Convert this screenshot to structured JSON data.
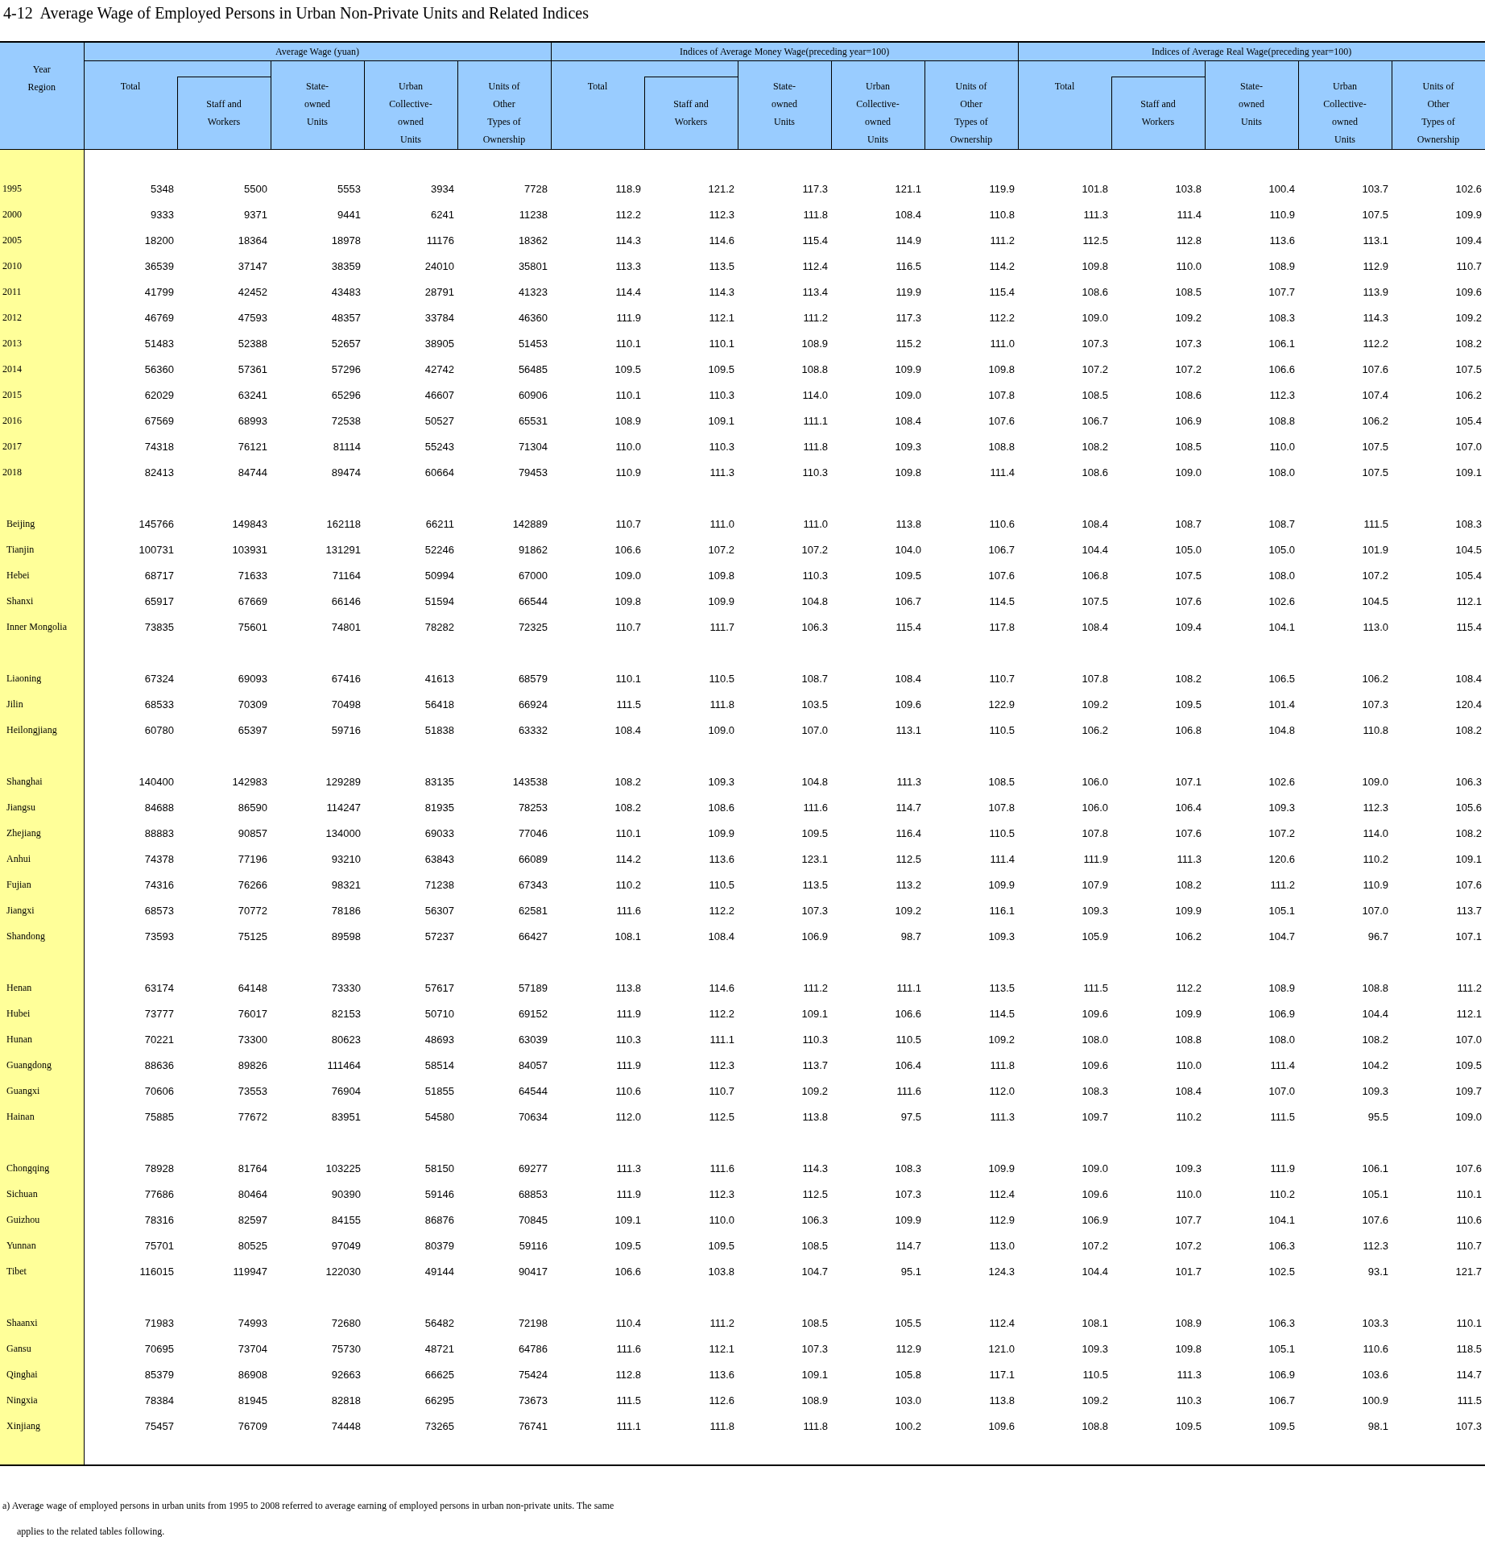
{
  "title": "4-12  Average Wage of Employed Persons in Urban Non-Private Units and Related Indices",
  "table": {
    "stub_header": "Year\nRegion",
    "column_groups": [
      {
        "title": "Average Wage  (yuan)",
        "columns": [
          {
            "label": "Total",
            "kind": "total"
          },
          {
            "label": "Staff and\nWorkers",
            "kind": "sub"
          },
          {
            "label": "State-\nowned\nUnits",
            "kind": "plain"
          },
          {
            "label": "Urban\nCollective-\nowned\nUnits",
            "kind": "plain"
          },
          {
            "label": "Units of\nOther\nTypes of\nOwnership",
            "kind": "plain"
          }
        ]
      },
      {
        "title": "Indices of Average Money Wage(preceding year=100)",
        "columns": [
          {
            "label": "Total",
            "kind": "total"
          },
          {
            "label": "Staff and\nWorkers",
            "kind": "sub"
          },
          {
            "label": "State-\nowned\nUnits",
            "kind": "plain"
          },
          {
            "label": "Urban\nCollective-\nowned\nUnits",
            "kind": "plain"
          },
          {
            "label": "Units of\nOther\nTypes of\nOwnership",
            "kind": "plain"
          }
        ]
      },
      {
        "title": "Indices of Average Real Wage(preceding year=100)",
        "columns": [
          {
            "label": "Total",
            "kind": "total"
          },
          {
            "label": "Staff and\nWorkers",
            "kind": "sub"
          },
          {
            "label": "State-\nowned\nUnits",
            "kind": "plain"
          },
          {
            "label": "Urban\nCollective-\nowned\nUnits",
            "kind": "plain"
          },
          {
            "label": "Units of\nOther\nTypes of\nOwnership",
            "kind": "plain"
          }
        ]
      }
    ],
    "row_groups": [
      {
        "kind": "years",
        "rows": [
          {
            "label": "1995",
            "values": [
              "5348",
              "5500",
              "5553",
              "3934",
              "7728",
              "118.9",
              "121.2",
              "117.3",
              "121.1",
              "119.9",
              "101.8",
              "103.8",
              "100.4",
              "103.7",
              "102.6"
            ]
          },
          {
            "label": "2000",
            "values": [
              "9333",
              "9371",
              "9441",
              "6241",
              "11238",
              "112.2",
              "112.3",
              "111.8",
              "108.4",
              "110.8",
              "111.3",
              "111.4",
              "110.9",
              "107.5",
              "109.9"
            ]
          },
          {
            "label": "2005",
            "values": [
              "18200",
              "18364",
              "18978",
              "11176",
              "18362",
              "114.3",
              "114.6",
              "115.4",
              "114.9",
              "111.2",
              "112.5",
              "112.8",
              "113.6",
              "113.1",
              "109.4"
            ]
          },
          {
            "label": "2010",
            "values": [
              "36539",
              "37147",
              "38359",
              "24010",
              "35801",
              "113.3",
              "113.5",
              "112.4",
              "116.5",
              "114.2",
              "109.8",
              "110.0",
              "108.9",
              "112.9",
              "110.7"
            ]
          },
          {
            "label": "2011",
            "values": [
              "41799",
              "42452",
              "43483",
              "28791",
              "41323",
              "114.4",
              "114.3",
              "113.4",
              "119.9",
              "115.4",
              "108.6",
              "108.5",
              "107.7",
              "113.9",
              "109.6"
            ]
          },
          {
            "label": "2012",
            "values": [
              "46769",
              "47593",
              "48357",
              "33784",
              "46360",
              "111.9",
              "112.1",
              "111.2",
              "117.3",
              "112.2",
              "109.0",
              "109.2",
              "108.3",
              "114.3",
              "109.2"
            ]
          },
          {
            "label": "2013",
            "values": [
              "51483",
              "52388",
              "52657",
              "38905",
              "51453",
              "110.1",
              "110.1",
              "108.9",
              "115.2",
              "111.0",
              "107.3",
              "107.3",
              "106.1",
              "112.2",
              "108.2"
            ]
          },
          {
            "label": "2014",
            "values": [
              "56360",
              "57361",
              "57296",
              "42742",
              "56485",
              "109.5",
              "109.5",
              "108.8",
              "109.9",
              "109.8",
              "107.2",
              "107.2",
              "106.6",
              "107.6",
              "107.5"
            ]
          },
          {
            "label": "2015",
            "values": [
              "62029",
              "63241",
              "65296",
              "46607",
              "60906",
              "110.1",
              "110.3",
              "114.0",
              "109.0",
              "107.8",
              "108.5",
              "108.6",
              "112.3",
              "107.4",
              "106.2"
            ]
          },
          {
            "label": "2016",
            "values": [
              "67569",
              "68993",
              "72538",
              "50527",
              "65531",
              "108.9",
              "109.1",
              "111.1",
              "108.4",
              "107.6",
              "106.7",
              "106.9",
              "108.8",
              "106.2",
              "105.4"
            ]
          },
          {
            "label": "2017",
            "values": [
              "74318",
              "76121",
              "81114",
              "55243",
              "71304",
              "110.0",
              "110.3",
              "111.8",
              "109.3",
              "108.8",
              "108.2",
              "108.5",
              "110.0",
              "107.5",
              "107.0"
            ]
          },
          {
            "label": "2018",
            "values": [
              "82413",
              "84744",
              "89474",
              "60664",
              "79453",
              "110.9",
              "111.3",
              "110.3",
              "109.8",
              "111.4",
              "108.6",
              "109.0",
              "108.0",
              "107.5",
              "109.1"
            ]
          }
        ]
      },
      {
        "kind": "regions",
        "rows": [
          {
            "label": "Beijing",
            "values": [
              "145766",
              "149843",
              "162118",
              "66211",
              "142889",
              "110.7",
              "111.0",
              "111.0",
              "113.8",
              "110.6",
              "108.4",
              "108.7",
              "108.7",
              "111.5",
              "108.3"
            ]
          },
          {
            "label": "Tianjin",
            "values": [
              "100731",
              "103931",
              "131291",
              "52246",
              "91862",
              "106.6",
              "107.2",
              "107.2",
              "104.0",
              "106.7",
              "104.4",
              "105.0",
              "105.0",
              "101.9",
              "104.5"
            ]
          },
          {
            "label": "Hebei",
            "values": [
              "68717",
              "71633",
              "71164",
              "50994",
              "67000",
              "109.0",
              "109.8",
              "110.3",
              "109.5",
              "107.6",
              "106.8",
              "107.5",
              "108.0",
              "107.2",
              "105.4"
            ]
          },
          {
            "label": "Shanxi",
            "values": [
              "65917",
              "67669",
              "66146",
              "51594",
              "66544",
              "109.8",
              "109.9",
              "104.8",
              "106.7",
              "114.5",
              "107.5",
              "107.6",
              "102.6",
              "104.5",
              "112.1"
            ]
          },
          {
            "label": "Inner Mongolia",
            "values": [
              "73835",
              "75601",
              "74801",
              "78282",
              "72325",
              "110.7",
              "111.7",
              "106.3",
              "115.4",
              "117.8",
              "108.4",
              "109.4",
              "104.1",
              "113.0",
              "115.4"
            ]
          }
        ]
      },
      {
        "kind": "regions",
        "rows": [
          {
            "label": "Liaoning",
            "values": [
              "67324",
              "69093",
              "67416",
              "41613",
              "68579",
              "110.1",
              "110.5",
              "108.7",
              "108.4",
              "110.7",
              "107.8",
              "108.2",
              "106.5",
              "106.2",
              "108.4"
            ]
          },
          {
            "label": "Jilin",
            "values": [
              "68533",
              "70309",
              "70498",
              "56418",
              "66924",
              "111.5",
              "111.8",
              "103.5",
              "109.6",
              "122.9",
              "109.2",
              "109.5",
              "101.4",
              "107.3",
              "120.4"
            ]
          },
          {
            "label": "Heilongjiang",
            "values": [
              "60780",
              "65397",
              "59716",
              "51838",
              "63332",
              "108.4",
              "109.0",
              "107.0",
              "113.1",
              "110.5",
              "106.2",
              "106.8",
              "104.8",
              "110.8",
              "108.2"
            ]
          }
        ]
      },
      {
        "kind": "regions",
        "rows": [
          {
            "label": "Shanghai",
            "values": [
              "140400",
              "142983",
              "129289",
              "83135",
              "143538",
              "108.2",
              "109.3",
              "104.8",
              "111.3",
              "108.5",
              "106.0",
              "107.1",
              "102.6",
              "109.0",
              "106.3"
            ]
          },
          {
            "label": "Jiangsu",
            "values": [
              "84688",
              "86590",
              "114247",
              "81935",
              "78253",
              "108.2",
              "108.6",
              "111.6",
              "114.7",
              "107.8",
              "106.0",
              "106.4",
              "109.3",
              "112.3",
              "105.6"
            ]
          },
          {
            "label": "Zhejiang",
            "values": [
              "88883",
              "90857",
              "134000",
              "69033",
              "77046",
              "110.1",
              "109.9",
              "109.5",
              "116.4",
              "110.5",
              "107.8",
              "107.6",
              "107.2",
              "114.0",
              "108.2"
            ]
          },
          {
            "label": "Anhui",
            "values": [
              "74378",
              "77196",
              "93210",
              "63843",
              "66089",
              "114.2",
              "113.6",
              "123.1",
              "112.5",
              "111.4",
              "111.9",
              "111.3",
              "120.6",
              "110.2",
              "109.1"
            ]
          },
          {
            "label": "Fujian",
            "values": [
              "74316",
              "76266",
              "98321",
              "71238",
              "67343",
              "110.2",
              "110.5",
              "113.5",
              "113.2",
              "109.9",
              "107.9",
              "108.2",
              "111.2",
              "110.9",
              "107.6"
            ]
          },
          {
            "label": "Jiangxi",
            "values": [
              "68573",
              "70772",
              "78186",
              "56307",
              "62581",
              "111.6",
              "112.2",
              "107.3",
              "109.2",
              "116.1",
              "109.3",
              "109.9",
              "105.1",
              "107.0",
              "113.7"
            ]
          },
          {
            "label": "Shandong",
            "values": [
              "73593",
              "75125",
              "89598",
              "57237",
              "66427",
              "108.1",
              "108.4",
              "106.9",
              "98.7",
              "109.3",
              "105.9",
              "106.2",
              "104.7",
              "96.7",
              "107.1"
            ]
          }
        ]
      },
      {
        "kind": "regions",
        "rows": [
          {
            "label": "Henan",
            "values": [
              "63174",
              "64148",
              "73330",
              "57617",
              "57189",
              "113.8",
              "114.6",
              "111.2",
              "111.1",
              "113.5",
              "111.5",
              "112.2",
              "108.9",
              "108.8",
              "111.2"
            ]
          },
          {
            "label": "Hubei",
            "values": [
              "73777",
              "76017",
              "82153",
              "50710",
              "69152",
              "111.9",
              "112.2",
              "109.1",
              "106.6",
              "114.5",
              "109.6",
              "109.9",
              "106.9",
              "104.4",
              "112.1"
            ]
          },
          {
            "label": "Hunan",
            "values": [
              "70221",
              "73300",
              "80623",
              "48693",
              "63039",
              "110.3",
              "111.1",
              "110.3",
              "110.5",
              "109.2",
              "108.0",
              "108.8",
              "108.0",
              "108.2",
              "107.0"
            ]
          },
          {
            "label": "Guangdong",
            "values": [
              "88636",
              "89826",
              "111464",
              "58514",
              "84057",
              "111.9",
              "112.3",
              "113.7",
              "106.4",
              "111.8",
              "109.6",
              "110.0",
              "111.4",
              "104.2",
              "109.5"
            ]
          },
          {
            "label": "Guangxi",
            "values": [
              "70606",
              "73553",
              "76904",
              "51855",
              "64544",
              "110.6",
              "110.7",
              "109.2",
              "111.6",
              "112.0",
              "108.3",
              "108.4",
              "107.0",
              "109.3",
              "109.7"
            ]
          },
          {
            "label": "Hainan",
            "values": [
              "75885",
              "77672",
              "83951",
              "54580",
              "70634",
              "112.0",
              "112.5",
              "113.8",
              "97.5",
              "111.3",
              "109.7",
              "110.2",
              "111.5",
              "95.5",
              "109.0"
            ]
          }
        ]
      },
      {
        "kind": "regions",
        "rows": [
          {
            "label": "Chongqing",
            "values": [
              "78928",
              "81764",
              "103225",
              "58150",
              "69277",
              "111.3",
              "111.6",
              "114.3",
              "108.3",
              "109.9",
              "109.0",
              "109.3",
              "111.9",
              "106.1",
              "107.6"
            ]
          },
          {
            "label": "Sichuan",
            "values": [
              "77686",
              "80464",
              "90390",
              "59146",
              "68853",
              "111.9",
              "112.3",
              "112.5",
              "107.3",
              "112.4",
              "109.6",
              "110.0",
              "110.2",
              "105.1",
              "110.1"
            ]
          },
          {
            "label": "Guizhou",
            "values": [
              "78316",
              "82597",
              "84155",
              "86876",
              "70845",
              "109.1",
              "110.0",
              "106.3",
              "109.9",
              "112.9",
              "106.9",
              "107.7",
              "104.1",
              "107.6",
              "110.6"
            ]
          },
          {
            "label": "Yunnan",
            "values": [
              "75701",
              "80525",
              "97049",
              "80379",
              "59116",
              "109.5",
              "109.5",
              "108.5",
              "114.7",
              "113.0",
              "107.2",
              "107.2",
              "106.3",
              "112.3",
              "110.7"
            ]
          },
          {
            "label": "Tibet",
            "values": [
              "116015",
              "119947",
              "122030",
              "49144",
              "90417",
              "106.6",
              "103.8",
              "104.7",
              "95.1",
              "124.3",
              "104.4",
              "101.7",
              "102.5",
              "93.1",
              "121.7"
            ]
          }
        ]
      },
      {
        "kind": "regions",
        "rows": [
          {
            "label": "Shaanxi",
            "values": [
              "71983",
              "74993",
              "72680",
              "56482",
              "72198",
              "110.4",
              "111.2",
              "108.5",
              "105.5",
              "112.4",
              "108.1",
              "108.9",
              "106.3",
              "103.3",
              "110.1"
            ]
          },
          {
            "label": "Gansu",
            "values": [
              "70695",
              "73704",
              "75730",
              "48721",
              "64786",
              "111.6",
              "112.1",
              "107.3",
              "112.9",
              "121.0",
              "109.3",
              "109.8",
              "105.1",
              "110.6",
              "118.5"
            ]
          },
          {
            "label": "Qinghai",
            "values": [
              "85379",
              "86908",
              "92663",
              "66625",
              "75424",
              "112.8",
              "113.6",
              "109.1",
              "105.8",
              "117.1",
              "110.5",
              "111.3",
              "106.9",
              "103.6",
              "114.7"
            ]
          },
          {
            "label": "Ningxia",
            "values": [
              "78384",
              "81945",
              "82818",
              "66295",
              "73673",
              "111.5",
              "112.6",
              "108.9",
              "103.0",
              "113.8",
              "109.2",
              "110.3",
              "106.7",
              "100.9",
              "111.5"
            ]
          },
          {
            "label": "Xinjiang",
            "values": [
              "75457",
              "76709",
              "74448",
              "73265",
              "76741",
              "111.1",
              "111.8",
              "111.8",
              "100.2",
              "109.6",
              "108.8",
              "109.5",
              "109.5",
              "98.1",
              "107.3"
            ]
          }
        ]
      }
    ]
  },
  "footnote": "a) Average wage of employed persons in urban units from 1995 to 2008 referred to average earning of employed persons in urban non-private units. The same applies to the related tables following."
}
